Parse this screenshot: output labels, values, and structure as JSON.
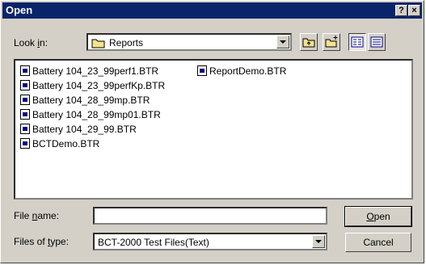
{
  "window": {
    "title": "Open",
    "help_label": "?",
    "close_label": "×"
  },
  "lookin": {
    "label_pre": "Look ",
    "label_u": "i",
    "label_post": "n:",
    "value": "Reports"
  },
  "files": [
    "Battery 104_23_99perf1.BTR",
    "Battery 104_23_99perfKp.BTR",
    "Battery 104_28_99mp.BTR",
    "Battery 104_28_99mp01.BTR",
    "Battery 104_29_99.BTR",
    "BCTDemo.BTR",
    "ReportDemo.BTR"
  ],
  "filename": {
    "label_pre": "File ",
    "label_u": "n",
    "label_post": "ame:",
    "value": ""
  },
  "filetype": {
    "label_pre": "Files of ",
    "label_u": "t",
    "label_post": "ype:",
    "value": "BCT-2000 Test Files(Text)"
  },
  "buttons": {
    "open_u": "O",
    "open_rest": "pen",
    "cancel": "Cancel"
  }
}
